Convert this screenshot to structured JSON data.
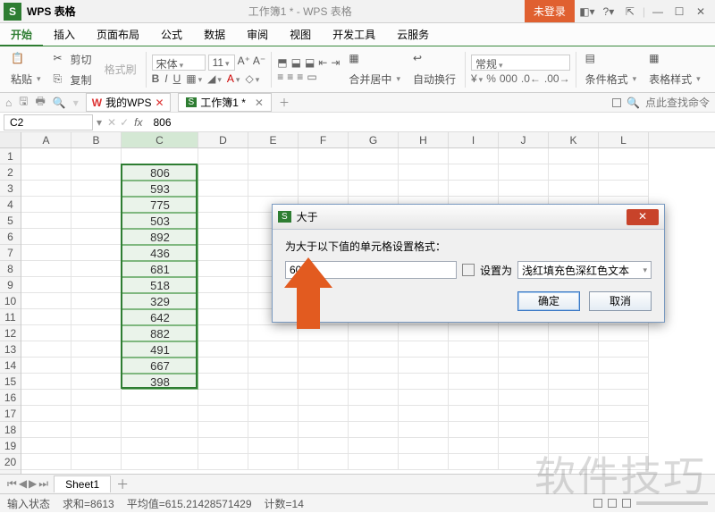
{
  "title": {
    "app": "WPS 表格",
    "doc_center": "工作簿1 * - WPS 表格",
    "nologin": "未登录"
  },
  "menu": {
    "items": [
      "开始",
      "插入",
      "页面布局",
      "公式",
      "数据",
      "审阅",
      "视图",
      "开发工具",
      "云服务"
    ],
    "active": 0
  },
  "ribbon": {
    "paste": "粘贴",
    "cut": "剪切",
    "copy": "复制",
    "formatpainter": "格式刷",
    "font": "宋体",
    "size": "11",
    "mergecenter": "合并居中",
    "autowrap": "自动换行",
    "numfmt": "常规",
    "condformat": "条件格式",
    "tablestyle": "表格样式"
  },
  "qat": {
    "mywps": "我的WPS",
    "workbook": "工作簿1 *",
    "search": "点此查找命令"
  },
  "cellref": {
    "name": "C2",
    "fx": "fx",
    "formula": "806"
  },
  "columns": [
    "A",
    "B",
    "C",
    "D",
    "E",
    "F",
    "G",
    "H",
    "I",
    "J",
    "K",
    "L"
  ],
  "rows": 20,
  "dataCol": "C",
  "dataStart": 2,
  "data": [
    806,
    593,
    775,
    503,
    892,
    436,
    681,
    518,
    329,
    642,
    882,
    491,
    667,
    398
  ],
  "dialog": {
    "title": "大于",
    "label": "为大于以下值的单元格设置格式：",
    "value": "600",
    "setas": "设置为",
    "style": "浅红填充色深红色文本",
    "ok": "确定",
    "cancel": "取消"
  },
  "sheets": {
    "name": "Sheet1"
  },
  "status": {
    "mode": "输入状态",
    "sum": "求和=8613",
    "avg": "平均值=615.21428571429",
    "count": "计数=14"
  },
  "watermark": "软件技巧"
}
